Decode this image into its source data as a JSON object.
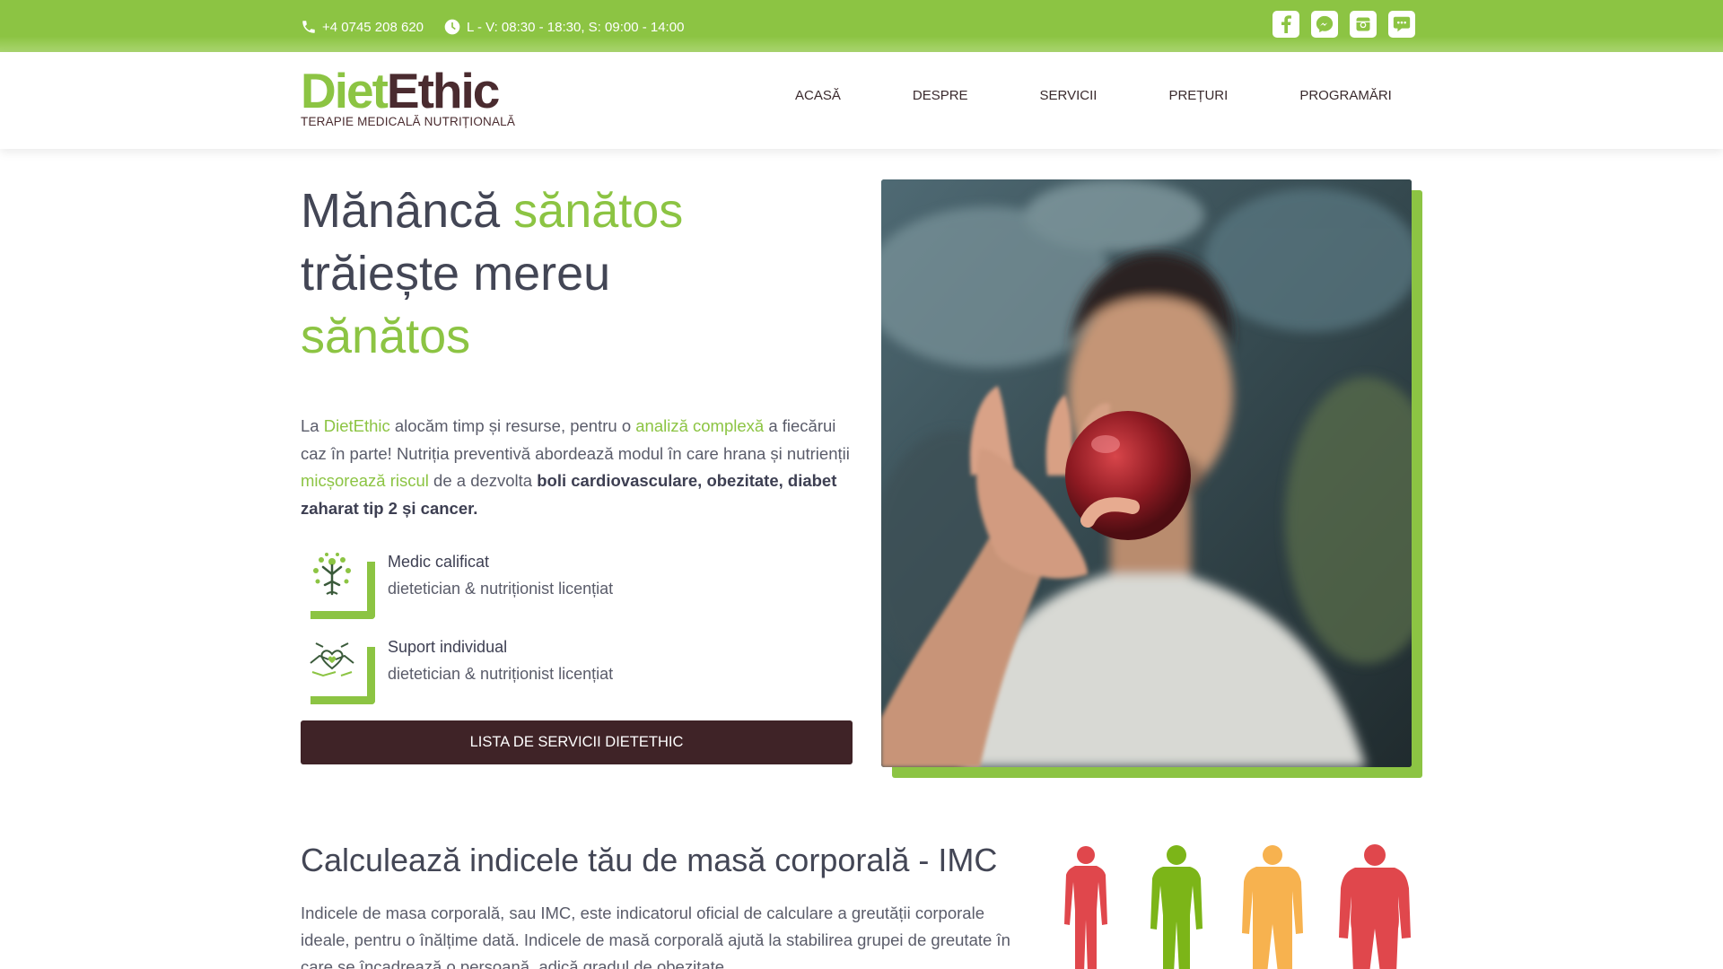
{
  "topbar": {
    "phone": "+4 0745 208 620",
    "hours": "L - V: 08:30 - 18:30, S: 09:00 - 14:00",
    "socials": [
      "facebook-icon",
      "messenger-icon",
      "instagram-icon",
      "chat-icon"
    ],
    "color": "#8cc443"
  },
  "header": {
    "logo_part1": "Diet",
    "logo_part2": "Ethic",
    "tagline": "TERAPIE MEDICALĂ NUTRIȚIONALĂ",
    "nav": [
      "ACASĂ",
      "DESPRE",
      "SERVICII",
      "PREȚURI",
      "PROGRAMĂRI"
    ]
  },
  "hero": {
    "title_w1": "Mănâncă ",
    "title_w2": "sănătos",
    "title_w3": "trăiește mereu",
    "title_w4": "sănătos",
    "p1": "La ",
    "p2": "DietEthic",
    "p3": " alocăm timp și resurse, pentru o ",
    "p4": "analiză complexă",
    "p5": " a fiecărui caz în parte! Nutriția preventivă abordează modul în care hrana și nutrienții ",
    "p6": "micșorează riscul",
    "p7": " de a dezvolta ",
    "p8": "boli cardiovasculare, obezitate, diabet zaharat tip 2 și cancer.",
    "features": [
      {
        "title": "Medic calificat",
        "subtitle": "dietetician & nutriționist licențiat"
      },
      {
        "title": "Suport individual",
        "subtitle": "dietetician & nutriționist licențiat"
      }
    ],
    "cta": "LISTA DE SERVICII DIETETHIC"
  },
  "imc": {
    "title": "Calculează indicele tău de masă corporală - IMC",
    "text": "Indicele de masa corporală, sau IMC, este indicatorul oficial de calculare a greutății corporale ideale, pentru o înălțime dată. Indicele de masă corporală ajută la stabilirea grupei de greutate în care se încadrează o persoană, adică gradul de obezitate.",
    "body_colors": [
      "#e0474c",
      "#7cb518",
      "#f7b24f",
      "#e0474c"
    ]
  }
}
